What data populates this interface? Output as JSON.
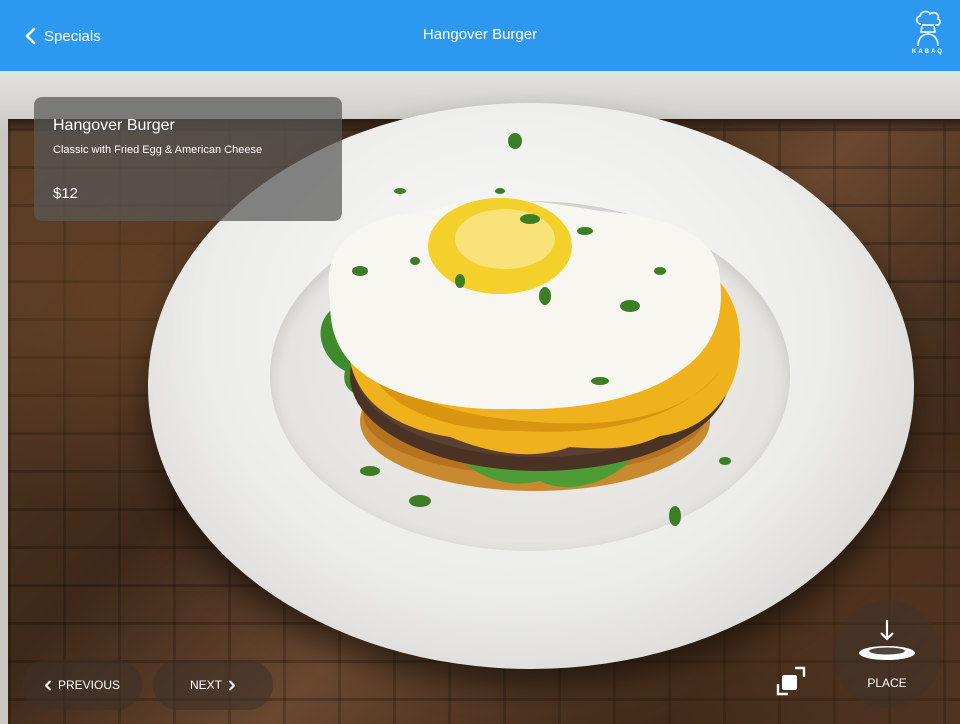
{
  "navbar": {
    "back_label": "Specials",
    "title": "Hangover Burger",
    "brand_text": "KABAQ",
    "background": "#2c98f0"
  },
  "item": {
    "name": "Hangover Burger",
    "description": "Classic with Fried Egg & American Cheese",
    "price": "$12"
  },
  "controls": {
    "previous_label": "PREVIOUS",
    "next_label": "NEXT",
    "place_label": "PLACE",
    "expand_icon": "expand-icon",
    "place_icon": "place-plate-icon"
  }
}
